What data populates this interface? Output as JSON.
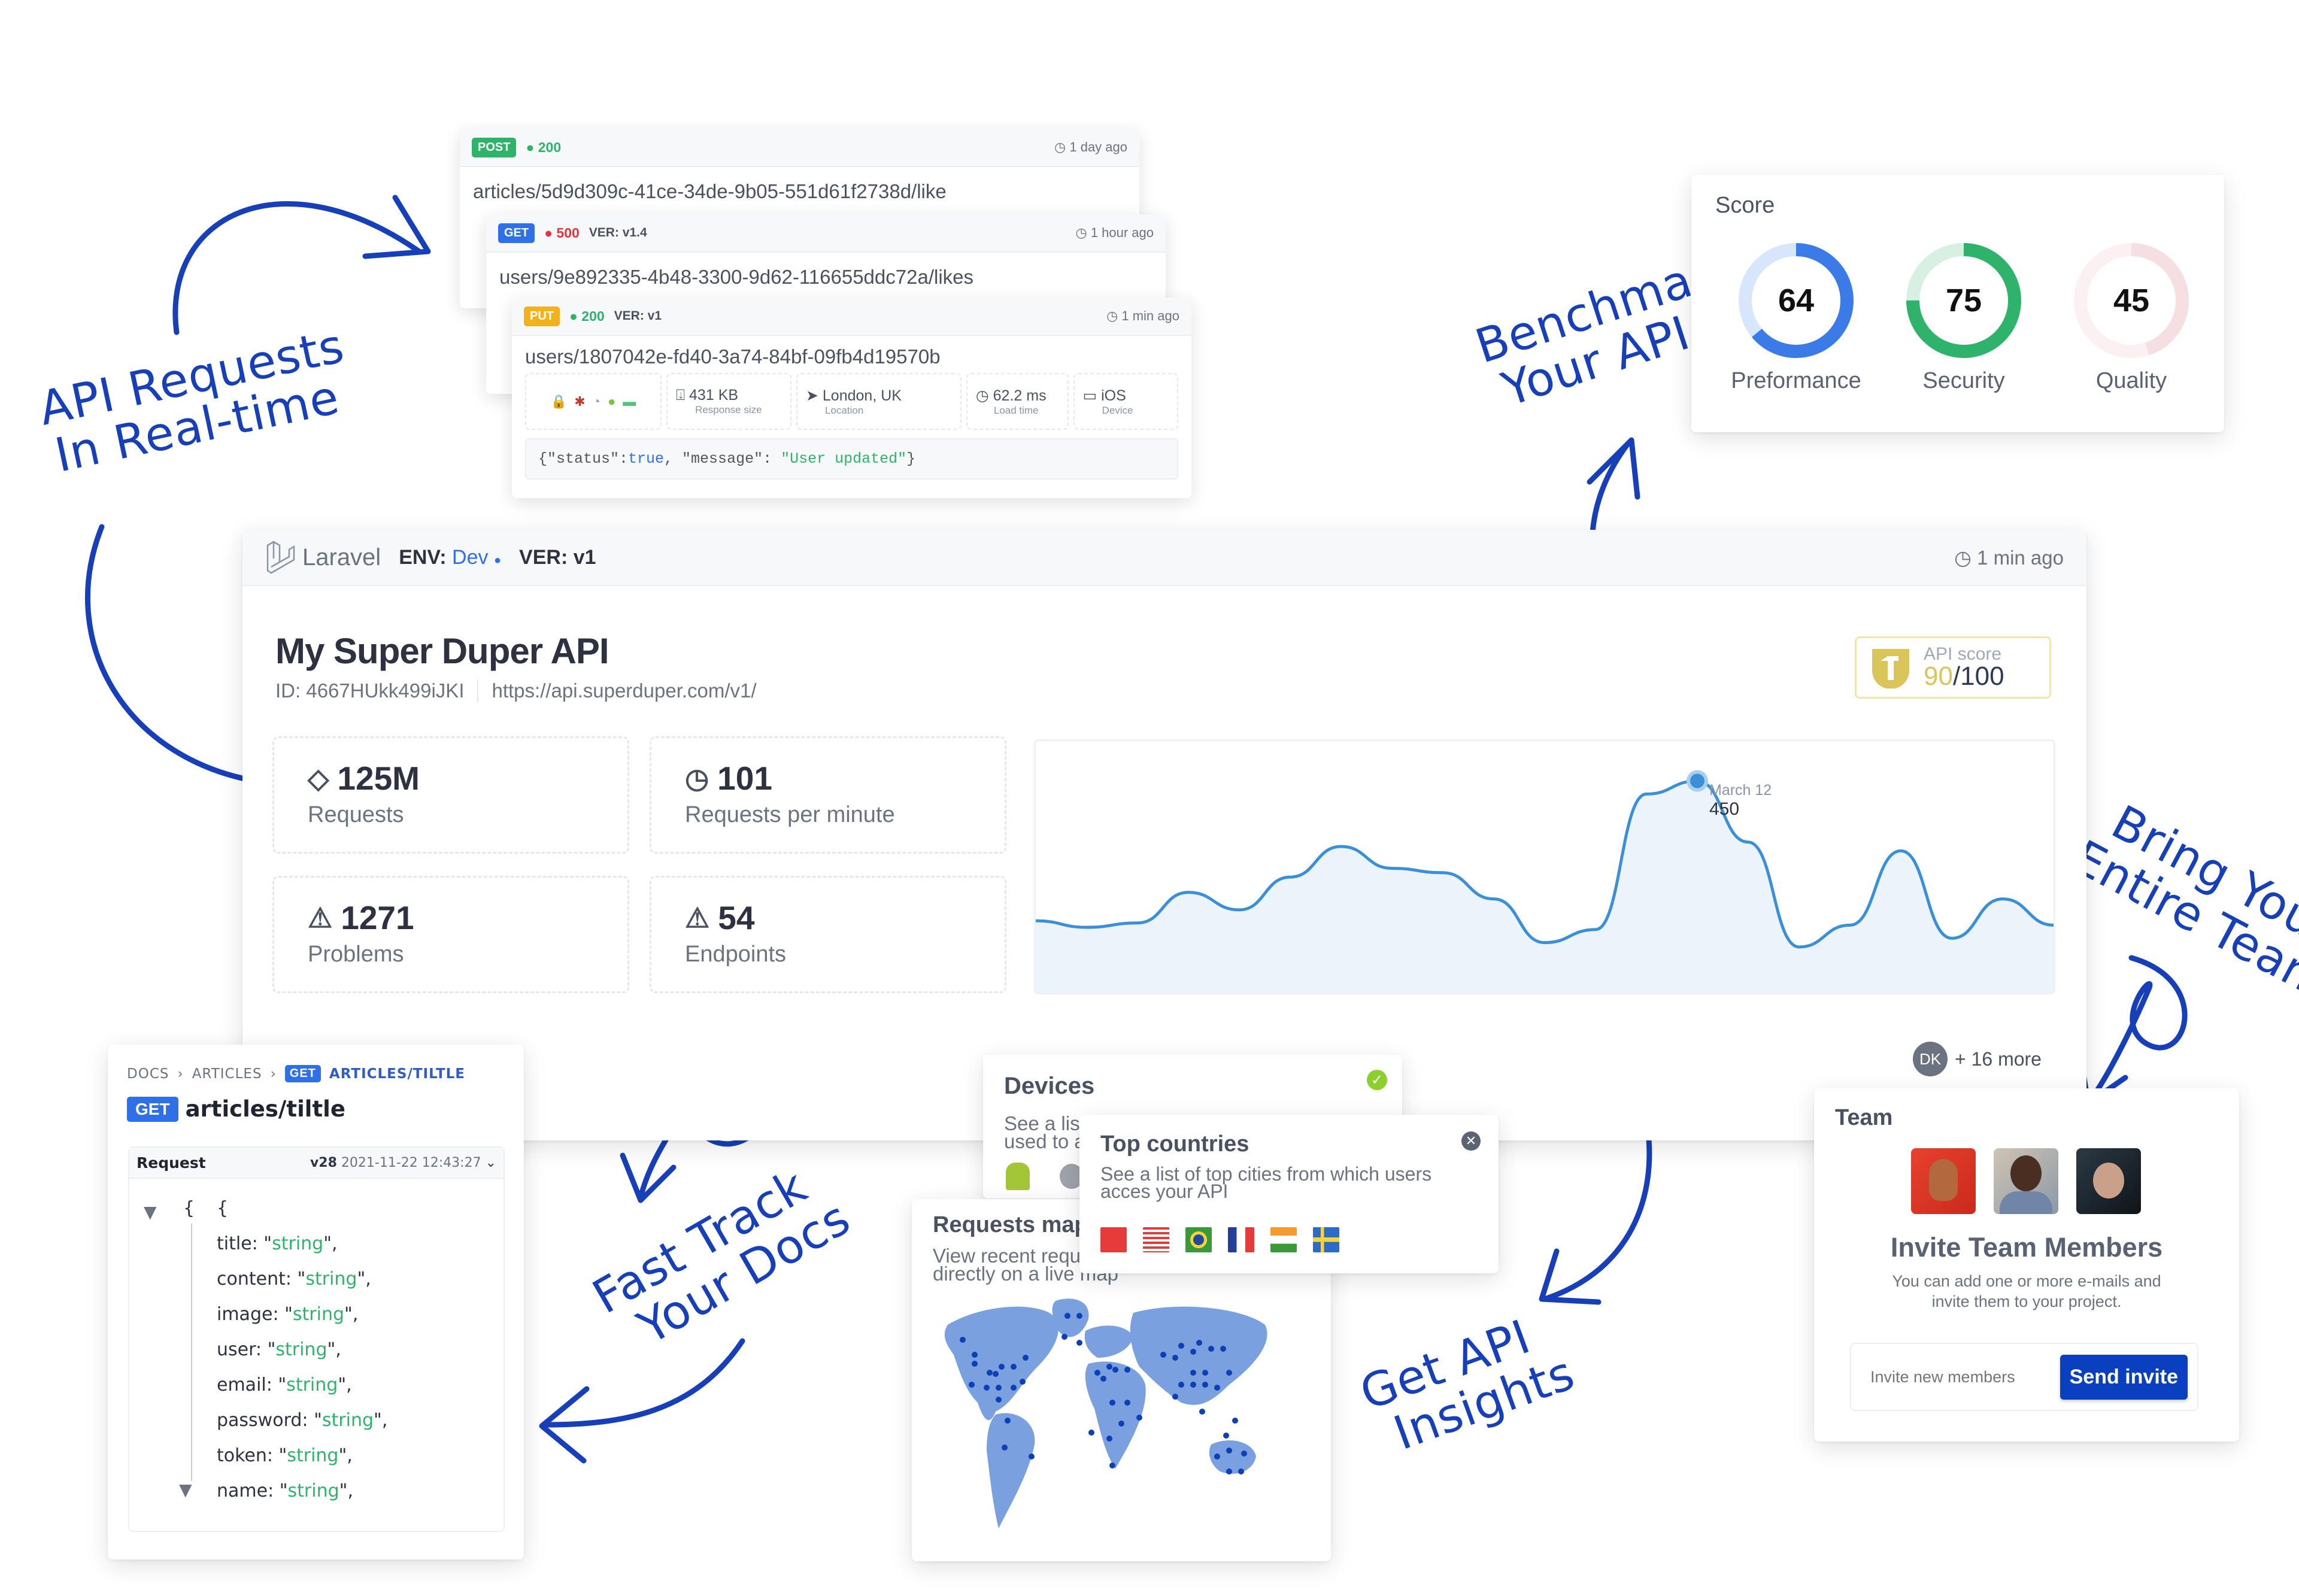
{
  "annotations": {
    "requests": [
      "API Requests",
      "In Real-time"
    ],
    "benchmark": [
      "Benchmark",
      "Your API"
    ],
    "team": [
      "Bring Your",
      "Entire Team"
    ],
    "docs": [
      "Fast Track",
      "Your Docs"
    ],
    "insights": [
      "Get API",
      "Insights"
    ]
  },
  "requests": [
    {
      "method": "POST",
      "method_color": "#2fb36b",
      "status": "200",
      "status_color": "#2fb36b",
      "version": "",
      "time": "1 day ago",
      "path": "articles/5d9d309c-41ce-34de-9b05-551d61f2738d/like"
    },
    {
      "method": "GET",
      "method_color": "#2f6fe8",
      "status": "500",
      "status_color": "#e5343d",
      "version": "VER: v1.4",
      "time": "1 hour ago",
      "path": "users/9e892335-4b48-3300-9d62-116655ddc72a/likes"
    },
    {
      "method": "PUT",
      "method_color": "#f2b21b",
      "status": "200",
      "status_color": "#2fb36b",
      "version": "VER: v1",
      "time": "1 min ago",
      "path": "users/1807042e-fd40-3a74-84bf-09fb4d19570b",
      "details": {
        "response_size": "431 KB",
        "response_size_label": "Response size",
        "location": "London, UK",
        "location_label": "Location",
        "load_time": "62.2 ms",
        "load_time_label": "Load time",
        "device": "iOS",
        "device_label": "Device"
      },
      "body": {
        "p1": "{\"status\":",
        "p2": "true",
        "p3": ", \"message\": ",
        "p4": "\"User updated\"",
        "p5": "}"
      }
    }
  ],
  "score": {
    "title": "Score",
    "items": [
      {
        "label": "Preformance",
        "value": 64,
        "color": "#3b7be8",
        "light": "#d8e6fb"
      },
      {
        "label": "Security",
        "value": 75,
        "color": "#2fb36b",
        "light": "#d7f0e2"
      },
      {
        "label": "Quality",
        "value": 45,
        "color": "#f6dfe2",
        "light": "#fbf1f2"
      }
    ]
  },
  "dashboard": {
    "framework": "Laravel",
    "env_label": "ENV:",
    "env_value": "Dev",
    "ver_label": "VER: v1",
    "updated": "1 min ago",
    "title": "My Super Duper API",
    "id": "ID: 4667HUkk499iJKI",
    "url": "https://api.superduper.com/v1/",
    "api_score_label": "API score",
    "api_score_value": "90",
    "api_score_max": "/100",
    "metrics": [
      {
        "icon": "tag-icon",
        "value": "125M",
        "label": "Requests"
      },
      {
        "icon": "clock-icon",
        "value": "101",
        "label": "Requests per minute"
      },
      {
        "icon": "warning-icon",
        "value": "1271",
        "label": "Problems"
      },
      {
        "icon": "warning-icon",
        "value": "54",
        "label": "Endpoints"
      }
    ],
    "team_avatar": "DK",
    "team_more": "+ 16 more"
  },
  "chart_data": {
    "type": "area",
    "title": "",
    "xlabel": "",
    "ylabel": "",
    "tooltip": {
      "label": "March 12",
      "value": "450"
    },
    "x": [
      0,
      1,
      2,
      3,
      4,
      5,
      6,
      7,
      8,
      9,
      10,
      11,
      12,
      13,
      14,
      15,
      16,
      17,
      18,
      19,
      20
    ],
    "values": [
      130,
      115,
      125,
      195,
      155,
      230,
      300,
      250,
      240,
      180,
      80,
      110,
      420,
      450,
      310,
      70,
      120,
      290,
      90,
      180,
      120
    ],
    "ylim": [
      0,
      500
    ],
    "grid": false
  },
  "docs": {
    "breadcrumb": [
      "DOCS",
      "ARTICLES"
    ],
    "breadcrumb_method": "GET",
    "breadcrumb_current": "ARTICLES/TILTLE",
    "method": "GET",
    "endpoint": "articles/tiltle",
    "panel_title": "Request",
    "panel_version": "v28",
    "panel_date": "2021-11-22 12:43:27",
    "fields": [
      {
        "key": "title",
        "value": "string"
      },
      {
        "key": "content",
        "value": "string"
      },
      {
        "key": "image",
        "value": "string"
      },
      {
        "key": "user",
        "value": "string"
      },
      {
        "key": "email",
        "value": "string"
      },
      {
        "key": "password",
        "value": "string"
      },
      {
        "key": "token",
        "value": "string"
      },
      {
        "key": "name",
        "value": "string"
      }
    ]
  },
  "devices": {
    "title": "Devices",
    "desc": "See a list of top devices that are used to access your API"
  },
  "countries": {
    "title": "Top countries",
    "desc": "See a list of top cities from which users acces your API",
    "flags": [
      "Turkey",
      "United States",
      "Brazil",
      "France",
      "India",
      "Sweden"
    ]
  },
  "map": {
    "title": "Requests map",
    "desc": "View recent requests to your API directly on a live map"
  },
  "team": {
    "title": "Team",
    "heading": "Invite Team Members",
    "desc": "You can add one or more e-mails and invite them to your project.",
    "input_placeholder": "Invite new members",
    "button": "Send invite"
  }
}
